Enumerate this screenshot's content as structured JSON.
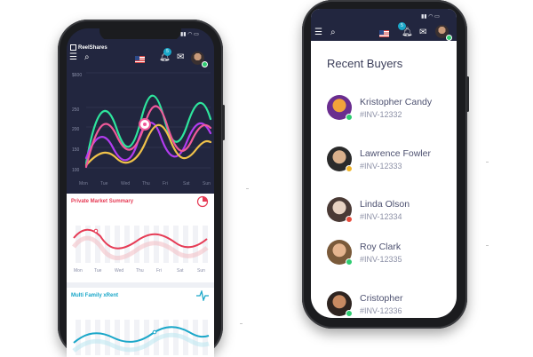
{
  "left_phone": {
    "brand": "ReelShares",
    "notification_count": "5",
    "chart_top": {
      "y_labels": [
        "$600",
        "250",
        "200",
        "150",
        "100"
      ],
      "days": [
        "Mon",
        "Tue",
        "Wed",
        "Thu",
        "Fri",
        "Sat",
        "Sun"
      ],
      "line_colors": [
        "#2ee59d",
        "#b23cf0",
        "#f0c24a",
        "#f05a9a"
      ]
    },
    "private_market": {
      "title": "Private Market Summary",
      "accent": "#e63b55",
      "days": [
        "Mon",
        "Tue",
        "Wed",
        "Thu",
        "Fri",
        "Sat",
        "Sun"
      ]
    },
    "multi_family": {
      "title": "Multi Family xRent",
      "accent": "#1aa7c9"
    }
  },
  "right_phone": {
    "notification_count": "5",
    "section_title": "Recent Buyers",
    "buyers": [
      {
        "name": "Kristopher Candy",
        "invoice": "#INV-12332",
        "status_color": "#2ecc71",
        "avatar_colors": [
          "#f2a23a",
          "#6a2d8f"
        ]
      },
      {
        "name": "Lawrence Fowler",
        "invoice": "#INV-12333",
        "status_color": "#f0b429",
        "avatar_colors": [
          "#d9b08c",
          "#2a2a2a"
        ]
      },
      {
        "name": "Linda Olson",
        "invoice": "#INV-12334",
        "status_color": "#e74c3c",
        "avatar_colors": [
          "#e7d2c2",
          "#4a3a35"
        ]
      },
      {
        "name": "Roy Clark",
        "invoice": "#INV-12335",
        "status_color": "#2ecc71",
        "avatar_colors": [
          "#e5b58f",
          "#7a5a3a"
        ]
      },
      {
        "name": "Cristopher",
        "invoice": "#INV-12336",
        "status_color": "#2ecc71",
        "avatar_colors": [
          "#c88a62",
          "#2e2420"
        ]
      }
    ]
  }
}
